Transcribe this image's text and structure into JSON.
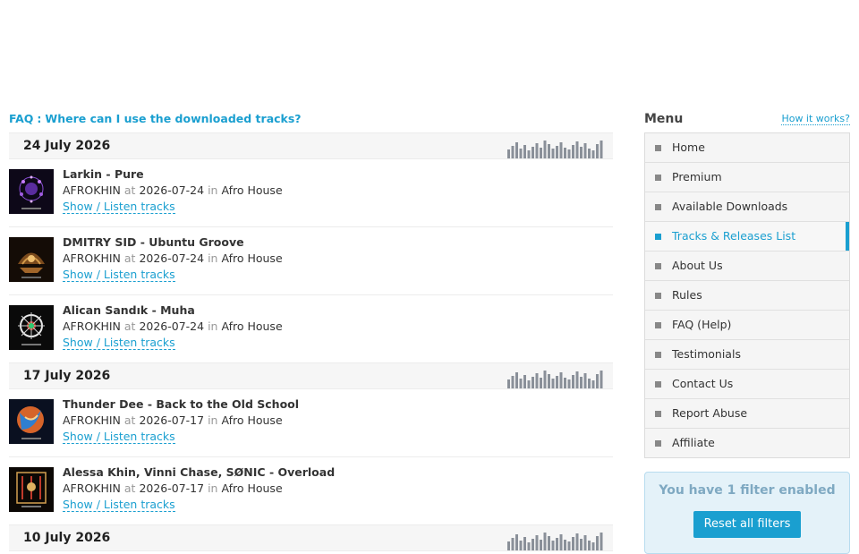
{
  "faq": {
    "link_label": "FAQ",
    "separator": ":",
    "question": "Where can I use the downloaded tracks?"
  },
  "groups": [
    {
      "date": "24 July 2026",
      "releases": [
        {
          "title": "Larkin - Pure",
          "label": "AFROKHIN",
          "at": "at",
          "date": "2026-07-24",
          "in": "in",
          "genre": "Afro House",
          "listen": "Show / Listen tracks",
          "cover_icon": "cover-art-image"
        },
        {
          "title": "DMITRY SID - Ubuntu Groove",
          "label": "AFROKHIN",
          "at": "at",
          "date": "2026-07-24",
          "in": "in",
          "genre": "Afro House",
          "listen": "Show / Listen tracks",
          "cover_icon": "cover-art-image"
        },
        {
          "title": "Alican Sandık - Muha",
          "label": "AFROKHIN",
          "at": "at",
          "date": "2026-07-24",
          "in": "in",
          "genre": "Afro House",
          "listen": "Show / Listen tracks",
          "cover_icon": "cover-art-image"
        }
      ]
    },
    {
      "date": "17 July 2026",
      "releases": [
        {
          "title": "Thunder Dee - Back to the Old School",
          "label": "AFROKHIN",
          "at": "at",
          "date": "2026-07-17",
          "in": "in",
          "genre": "Afro House",
          "listen": "Show / Listen tracks",
          "cover_icon": "cover-art-image"
        },
        {
          "title": "Alessa Khin, Vinni Chase, SØNIC - Overload",
          "label": "AFROKHIN",
          "at": "at",
          "date": "2026-07-17",
          "in": "in",
          "genre": "Afro House",
          "listen": "Show / Listen tracks",
          "cover_icon": "cover-art-image"
        }
      ]
    },
    {
      "date": "10 July 2026",
      "releases": []
    }
  ],
  "sidebar": {
    "menu_title": "Menu",
    "how_link": "How it works?",
    "items": [
      {
        "label": "Home",
        "active": false
      },
      {
        "label": "Premium",
        "active": false
      },
      {
        "label": "Available Downloads",
        "active": false
      },
      {
        "label": "Tracks & Releases List",
        "active": true
      },
      {
        "label": "About Us",
        "active": false
      },
      {
        "label": "Rules",
        "active": false
      },
      {
        "label": "FAQ (Help)",
        "active": false
      },
      {
        "label": "Testimonials",
        "active": false
      },
      {
        "label": "Contact Us",
        "active": false
      },
      {
        "label": "Report Abuse",
        "active": false
      },
      {
        "label": "Affiliate",
        "active": false
      }
    ],
    "filter_text": "You have 1 filter enabled",
    "reset_label": "Reset all filters"
  },
  "colors": {
    "accent": "#1a9fd0",
    "filter_bg": "#e4f2f9"
  }
}
